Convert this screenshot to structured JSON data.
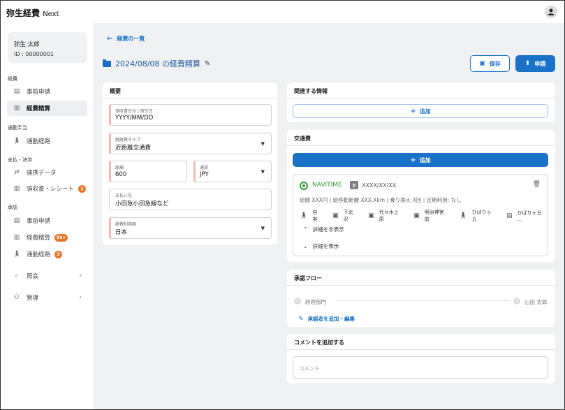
{
  "app": {
    "brand": "弥生経費",
    "brand_suffix": "Next"
  },
  "user": {
    "name": "弥生 太郎",
    "id": "ID : 00000001"
  },
  "sidebar": {
    "sections": [
      {
        "label": "経費"
      },
      {
        "label": "通勤手当"
      },
      {
        "label": "支払・決済"
      },
      {
        "label": "承認"
      }
    ],
    "items": [
      {
        "label": "事前申請",
        "icon": "document-icon"
      },
      {
        "label": "経費精算",
        "icon": "receipt-icon",
        "active": true
      },
      {
        "label": "通勤経路",
        "icon": "walk-icon"
      },
      {
        "label": "連携データ",
        "icon": "sync-icon"
      },
      {
        "label": "領収書・レシート",
        "icon": "receipt-icon",
        "badge": "1"
      },
      {
        "label": "事前申請",
        "icon": "document-icon"
      },
      {
        "label": "経費精算",
        "icon": "receipt-icon",
        "badge": "99+"
      },
      {
        "label": "通勤経路",
        "icon": "walk-icon",
        "badge": "3"
      },
      {
        "label": "照会",
        "icon": "search-icon"
      },
      {
        "label": "管理",
        "icon": "people-icon"
      }
    ]
  },
  "header": {
    "back_label": "経費の一覧",
    "title": "2024/08/08 の経費精算",
    "save_label": "保存",
    "apply_label": "申請"
  },
  "overview": {
    "title": "概要",
    "receipt_date": {
      "label": "領収書日付 / 取引日",
      "value": "YYYY/MM/DD"
    },
    "expense_type": {
      "label": "経経費タイプ",
      "value": "近距離交通費"
    },
    "amount": {
      "label": "総額",
      "value": "600"
    },
    "currency": {
      "label": "通貨",
      "value": "JPY"
    },
    "payee": {
      "label": "支払い先",
      "value": "小田急小田急線など"
    },
    "region": {
      "label": "経費利用国",
      "value": "日本"
    }
  },
  "related": {
    "title": "関連する情報",
    "add_label": "追加"
  },
  "transport": {
    "title": "交通費",
    "add_label": "追加",
    "provider": "NAVITIME",
    "tag": "孝",
    "date": "XXXX/XX/XX",
    "summary": "総額 XXX円 | 総移動距離 XXX.Xkm | 乗り換え X回 | 定期利用: なし",
    "stations": [
      {
        "name": "自宅",
        "icon": "walk-icon"
      },
      {
        "name": "下北沢",
        "icon": "train-icon"
      },
      {
        "name": "代々木上原",
        "icon": "train-icon"
      },
      {
        "name": "明治神宮前",
        "icon": "train-icon"
      },
      {
        "name": "ひばりヶ丘",
        "icon": "walk-icon"
      },
      {
        "name": "ひばりヶ丘 ...",
        "icon": "bus-icon"
      }
    ],
    "hide_details": "詳細を非表示",
    "show_details": "詳細を表示"
  },
  "approval": {
    "title": "承認フロー",
    "step1_num": "1",
    "step1": "経理部門",
    "step2_num": "2",
    "step2": "山田 太郎",
    "edit_label": "承認者を追加・編集"
  },
  "comment": {
    "title": "コメントを追加する",
    "placeholder": "コメント"
  }
}
